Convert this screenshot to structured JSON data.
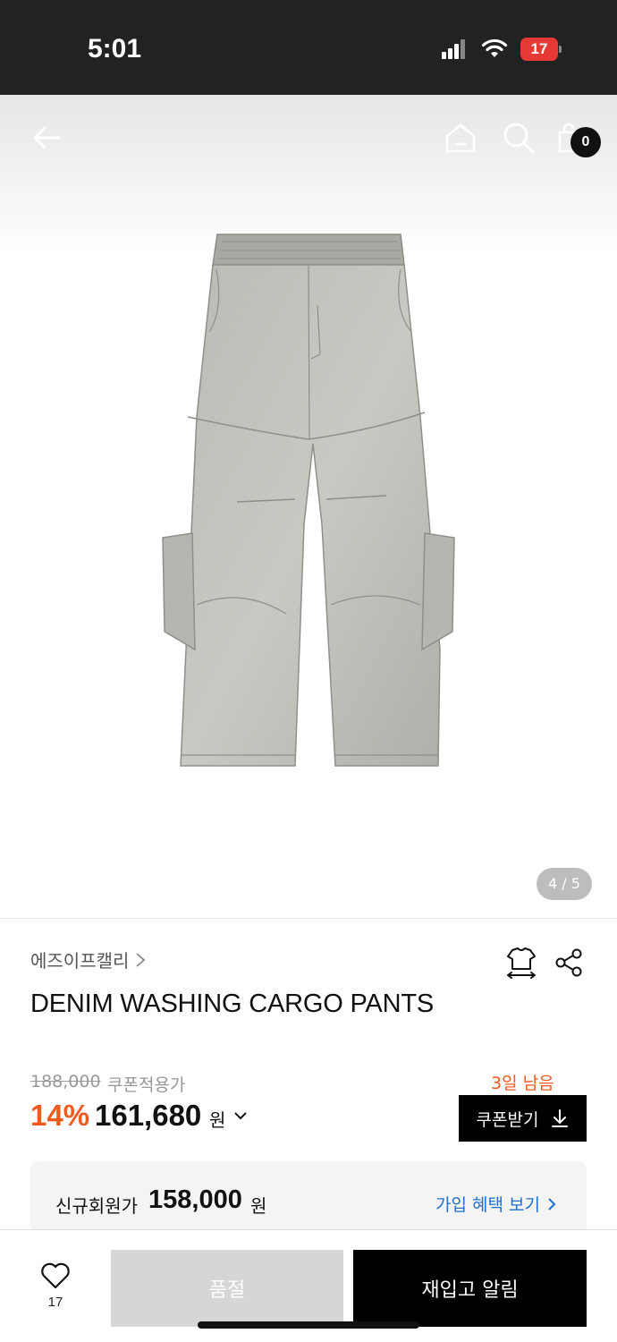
{
  "status_bar": {
    "time": "5:01",
    "battery": "17"
  },
  "header": {
    "cart_count": "0",
    "icons": [
      "back-arrow-icon",
      "home-icon",
      "search-icon",
      "cart-icon"
    ]
  },
  "gallery": {
    "indicator": "4 / 5"
  },
  "product": {
    "brand": "에즈이프캘리",
    "title": "DENIM WASHING CARGO PANTS",
    "original_price": "188,000",
    "coupon_price_label": "쿠폰적용가",
    "discount": "14%",
    "sale_price": "161,680",
    "currency": "원"
  },
  "coupon": {
    "days_left": "3일 남음",
    "button_label": "쿠폰받기"
  },
  "member": {
    "label": "신규회원가",
    "price": "158,000",
    "currency": "원",
    "link_label": "가입 혜택 보기"
  },
  "bottom_bar": {
    "like_count": "17",
    "soldout_label": "품절",
    "restock_label": "재입고 알림"
  },
  "colors": {
    "accent_orange": "#ef5a1e",
    "link_blue": "#1f6fd1",
    "battery_red": "#e53935"
  }
}
